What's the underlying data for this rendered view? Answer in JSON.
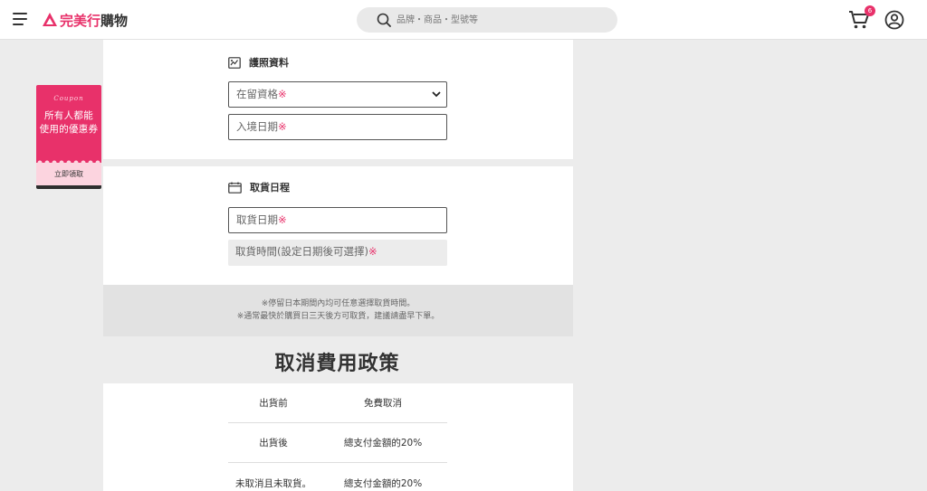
{
  "header": {
    "logo_text_pink": "完美行",
    "logo_text_dark": "購物",
    "search_placeholder": "品牌・商品・型號等",
    "cart_count": "6"
  },
  "coupon": {
    "word": "Coupon",
    "line1": "所有人都能",
    "line2": "使用的優惠券",
    "action": "立即領取"
  },
  "passport": {
    "title": "護照資料",
    "residence_label": "在留資格",
    "entry_date_label": "入境日期",
    "required_mark": "※"
  },
  "pickup": {
    "title": "取貨日程",
    "date_label": "取貨日期",
    "time_label": "取貨時間(設定日期後可選擇)",
    "required_mark": "※"
  },
  "notes": {
    "line1": "※停留日本期間內均可任意選擇取貨時間。",
    "line2": "※通常最快於購買日三天後方可取貨，建議請盡早下單。"
  },
  "policy": {
    "title": "取消費用政策",
    "rows": [
      {
        "condition": "出貨前",
        "fee": "免費取消"
      },
      {
        "condition": "出貨後",
        "fee": "總支付金額的20%"
      },
      {
        "condition": "未取消且未取貨。",
        "fee": "總支付金額的20%"
      }
    ]
  },
  "colors": {
    "accent": "#e8316a",
    "page_bg": "#ececec"
  }
}
